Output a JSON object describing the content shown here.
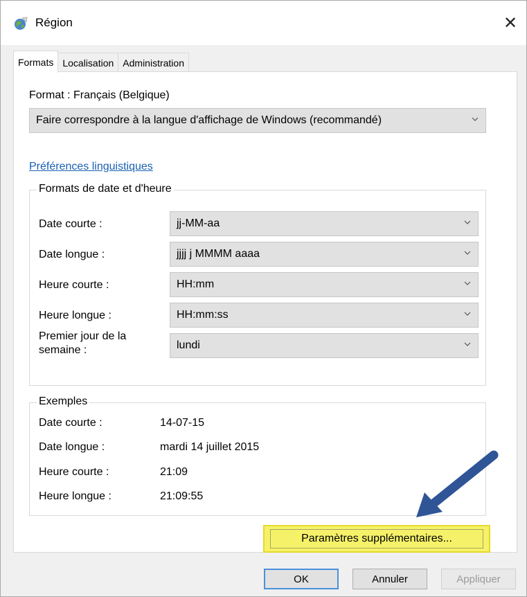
{
  "window": {
    "title": "Région",
    "close_glyph": "✕"
  },
  "tabs": [
    {
      "label": "Formats",
      "active": true
    },
    {
      "label": "Localisation",
      "active": false
    },
    {
      "label": "Administration",
      "active": false
    }
  ],
  "format": {
    "label": "Format : Français (Belgique)",
    "selected": "Faire correspondre à la langue d'affichage de Windows (recommandé)"
  },
  "preferences_link": "Préférences linguistiques",
  "date_time_group": {
    "legend": "Formats de date et d'heure",
    "rows": [
      {
        "label": "Date courte :",
        "value": "jj-MM-aa"
      },
      {
        "label": "Date longue :",
        "value": "jjjj j MMMM aaaa"
      },
      {
        "label": "Heure courte :",
        "value": "HH:mm"
      },
      {
        "label": "Heure longue :",
        "value": "HH:mm:ss"
      },
      {
        "label": "Premier jour de la semaine :",
        "label_line1": "Premier jour de la",
        "label_line2": "semaine :",
        "value": "lundi"
      }
    ]
  },
  "examples_group": {
    "legend": "Exemples",
    "rows": [
      {
        "label": "Date courte :",
        "value": "14-07-15"
      },
      {
        "label": "Date longue :",
        "value": "mardi 14 juillet 2015"
      },
      {
        "label": "Heure courte :",
        "value": "21:09"
      },
      {
        "label": "Heure longue :",
        "value": "21:09:55"
      }
    ]
  },
  "buttons": {
    "additional": "Paramètres supplémentaires...",
    "ok": "OK",
    "cancel": "Annuler",
    "apply": "Appliquer"
  },
  "colors": {
    "highlight": "#f5f26a",
    "arrow": "#2f5597",
    "link": "#1a5fb4"
  },
  "icons": {
    "title": "globe-region-icon",
    "close": "close-icon",
    "dropdown": "chevron-down-icon",
    "annotation": "annotation-arrow-icon"
  }
}
